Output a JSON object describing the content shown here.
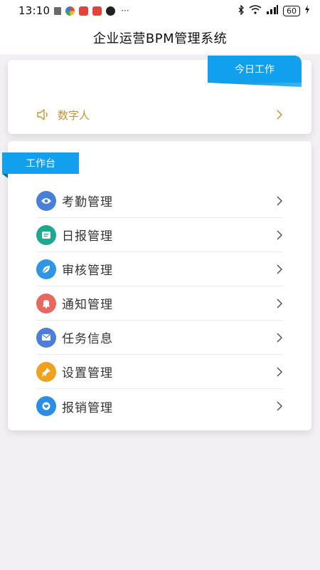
{
  "status_bar": {
    "time": "13:10",
    "dots": "···",
    "battery": "60",
    "icons": [
      "bluetooth-icon",
      "wifi-icon",
      "signal-icon",
      "battery-icon",
      "charging-icon"
    ]
  },
  "header": {
    "title": "企业运营BPM管理系统"
  },
  "today_card": {
    "ribbon_label": "今日工作",
    "item": {
      "label": "数字人",
      "icon": "speaker-icon",
      "color": "#c8932a"
    }
  },
  "workbench": {
    "ribbon_label": "工作台",
    "items": [
      {
        "label": "考勤管理",
        "icon": "eye-icon",
        "color": "#4a7fd8"
      },
      {
        "label": "日报管理",
        "icon": "chat-icon",
        "color": "#1fa88e"
      },
      {
        "label": "审核管理",
        "icon": "leaf-icon",
        "color": "#2f95e6"
      },
      {
        "label": "通知管理",
        "icon": "bell-icon",
        "color": "#e8675f"
      },
      {
        "label": "任务信息",
        "icon": "mail-icon",
        "color": "#4d7fd9"
      },
      {
        "label": "设置管理",
        "icon": "pin-icon",
        "color": "#f0a21f"
      },
      {
        "label": "报销管理",
        "icon": "heart-icon",
        "color": "#2a8ee2"
      }
    ]
  },
  "colors": {
    "accent": "#10a0ee",
    "gold": "#c8932a",
    "background": "#f2f0f2"
  }
}
